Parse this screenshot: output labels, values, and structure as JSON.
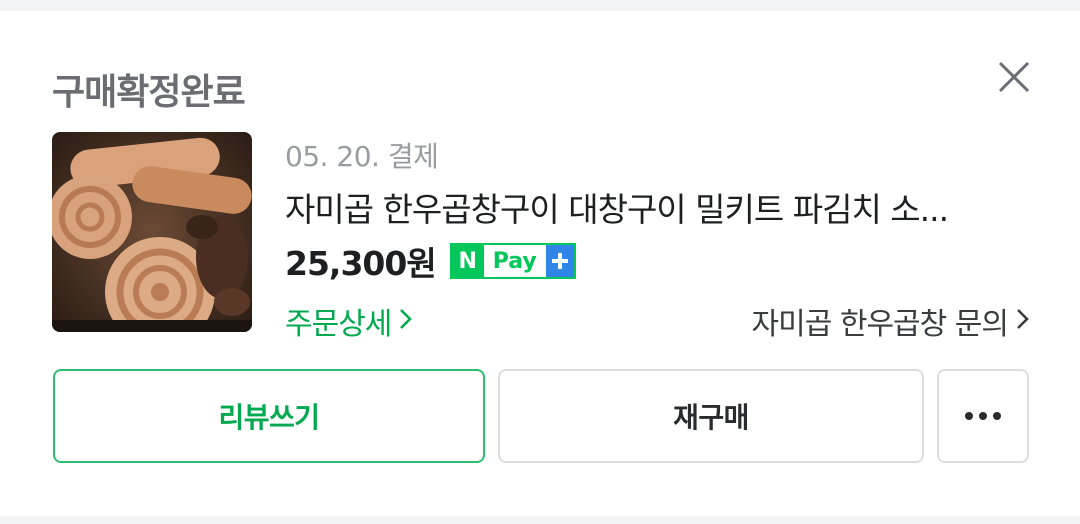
{
  "header": {
    "title": "구매확정완료",
    "close_icon": "close-icon"
  },
  "order": {
    "date_label": "05. 20. 결제",
    "product_name": "자미곱 한우곱창구이 대창구이 밀키트 파김치 소...",
    "price": "25,300원",
    "npay": {
      "n": "N",
      "pay": "Pay",
      "plus": "+"
    },
    "detail_link": "주문상세",
    "inquiry_link": "자미곱 한우곱창 문의",
    "thumbnail": "product-thumbnail"
  },
  "actions": {
    "review": "리뷰쓰기",
    "rebuy": "재구매",
    "more_icon": "more-icon"
  },
  "colors": {
    "accent_green": "#03c75a",
    "link_green": "#03a94f",
    "npay_plus_blue": "#2f86e8"
  }
}
